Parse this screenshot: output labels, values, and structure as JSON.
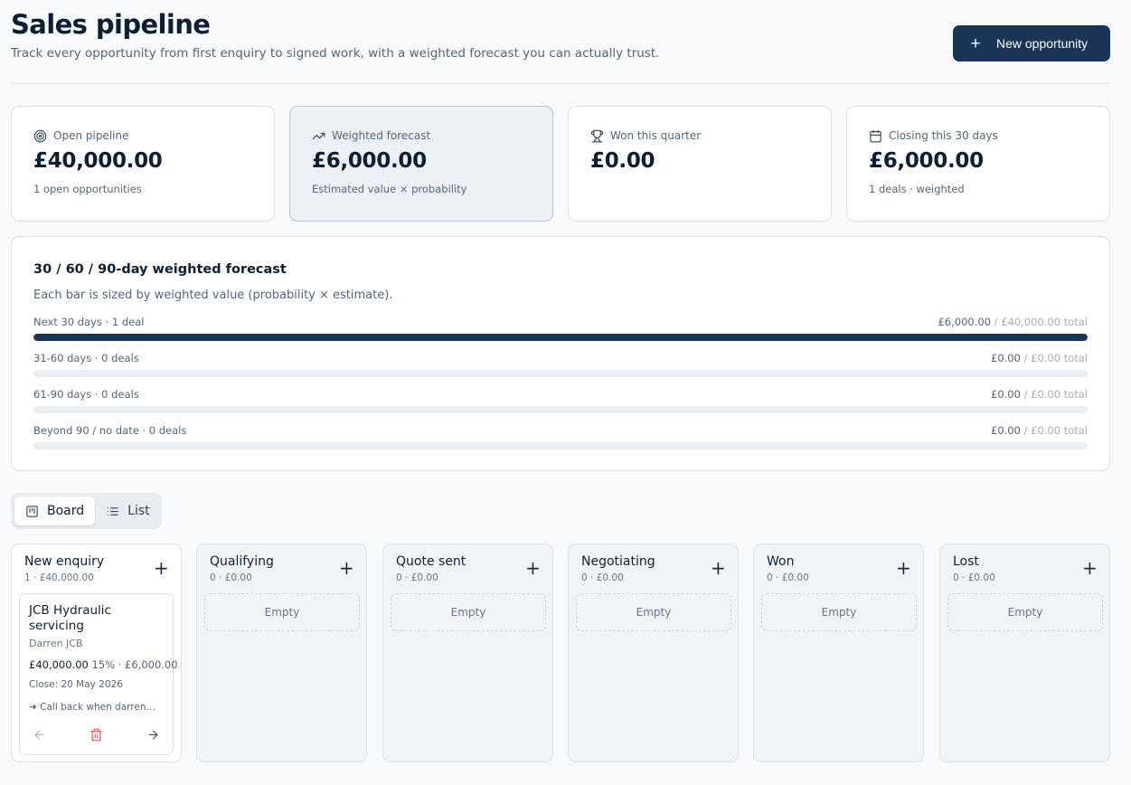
{
  "header": {
    "title": "Sales pipeline",
    "subtitle": "Track every opportunity from first enquiry to signed work, with a weighted forecast you can actually trust.",
    "new_button": "New opportunity"
  },
  "stats": [
    {
      "label": "Open pipeline",
      "value": "£40,000.00",
      "note": "1 open opportunities",
      "icon": "target-icon"
    },
    {
      "label": "Weighted forecast",
      "value": "£6,000.00",
      "note": "Estimated value × probability",
      "icon": "trending-up-icon"
    },
    {
      "label": "Won this quarter",
      "value": "£0.00",
      "note": "",
      "icon": "trophy-icon"
    },
    {
      "label": "Closing this 30 days",
      "value": "£6,000.00",
      "note": "1 deals · weighted",
      "icon": "calendar-icon"
    }
  ],
  "forecast": {
    "title": "30 / 60 / 90-day weighted forecast",
    "subtitle": "Each bar is sized by weighted value (probability × estimate).",
    "rows": [
      {
        "label": "Next 30 days · 1 deal",
        "amount": "£6,000.00",
        "total": " / £40,000.00 total",
        "fill": 1.0
      },
      {
        "label": "31-60 days · 0 deals",
        "amount": "£0.00",
        "total": " / £0.00 total",
        "fill": 0
      },
      {
        "label": "61-90 days · 0 deals",
        "amount": "£0.00",
        "total": " / £0.00 total",
        "fill": 0
      },
      {
        "label": "Beyond 90 / no date · 0 deals",
        "amount": "£0.00",
        "total": " / £0.00 total",
        "fill": 0
      }
    ]
  },
  "view_toggle": {
    "board": "Board",
    "list": "List",
    "selected": "Board"
  },
  "board": {
    "empty_label": "Empty",
    "columns": [
      {
        "name": "New enquiry",
        "meta": "1 · £40,000.00"
      },
      {
        "name": "Qualifying",
        "meta": "0 · £0.00"
      },
      {
        "name": "Quote sent",
        "meta": "0 · £0.00"
      },
      {
        "name": "Negotiating",
        "meta": "0 · £0.00"
      },
      {
        "name": "Won",
        "meta": "0 · £0.00"
      },
      {
        "name": "Lost",
        "meta": "0 · £0.00"
      }
    ],
    "card": {
      "title": "JCB Hydraulic servicing",
      "contact": "Darren JCB",
      "value": "£40,000.00",
      "probability": "15% · £6,000.00",
      "close": "Close: 20 May 2026",
      "next_action": "➜ Call back when darren…"
    }
  },
  "colors": {
    "primary": "#1b3556",
    "delete": "#ef4444",
    "background": "#f8fafc"
  }
}
